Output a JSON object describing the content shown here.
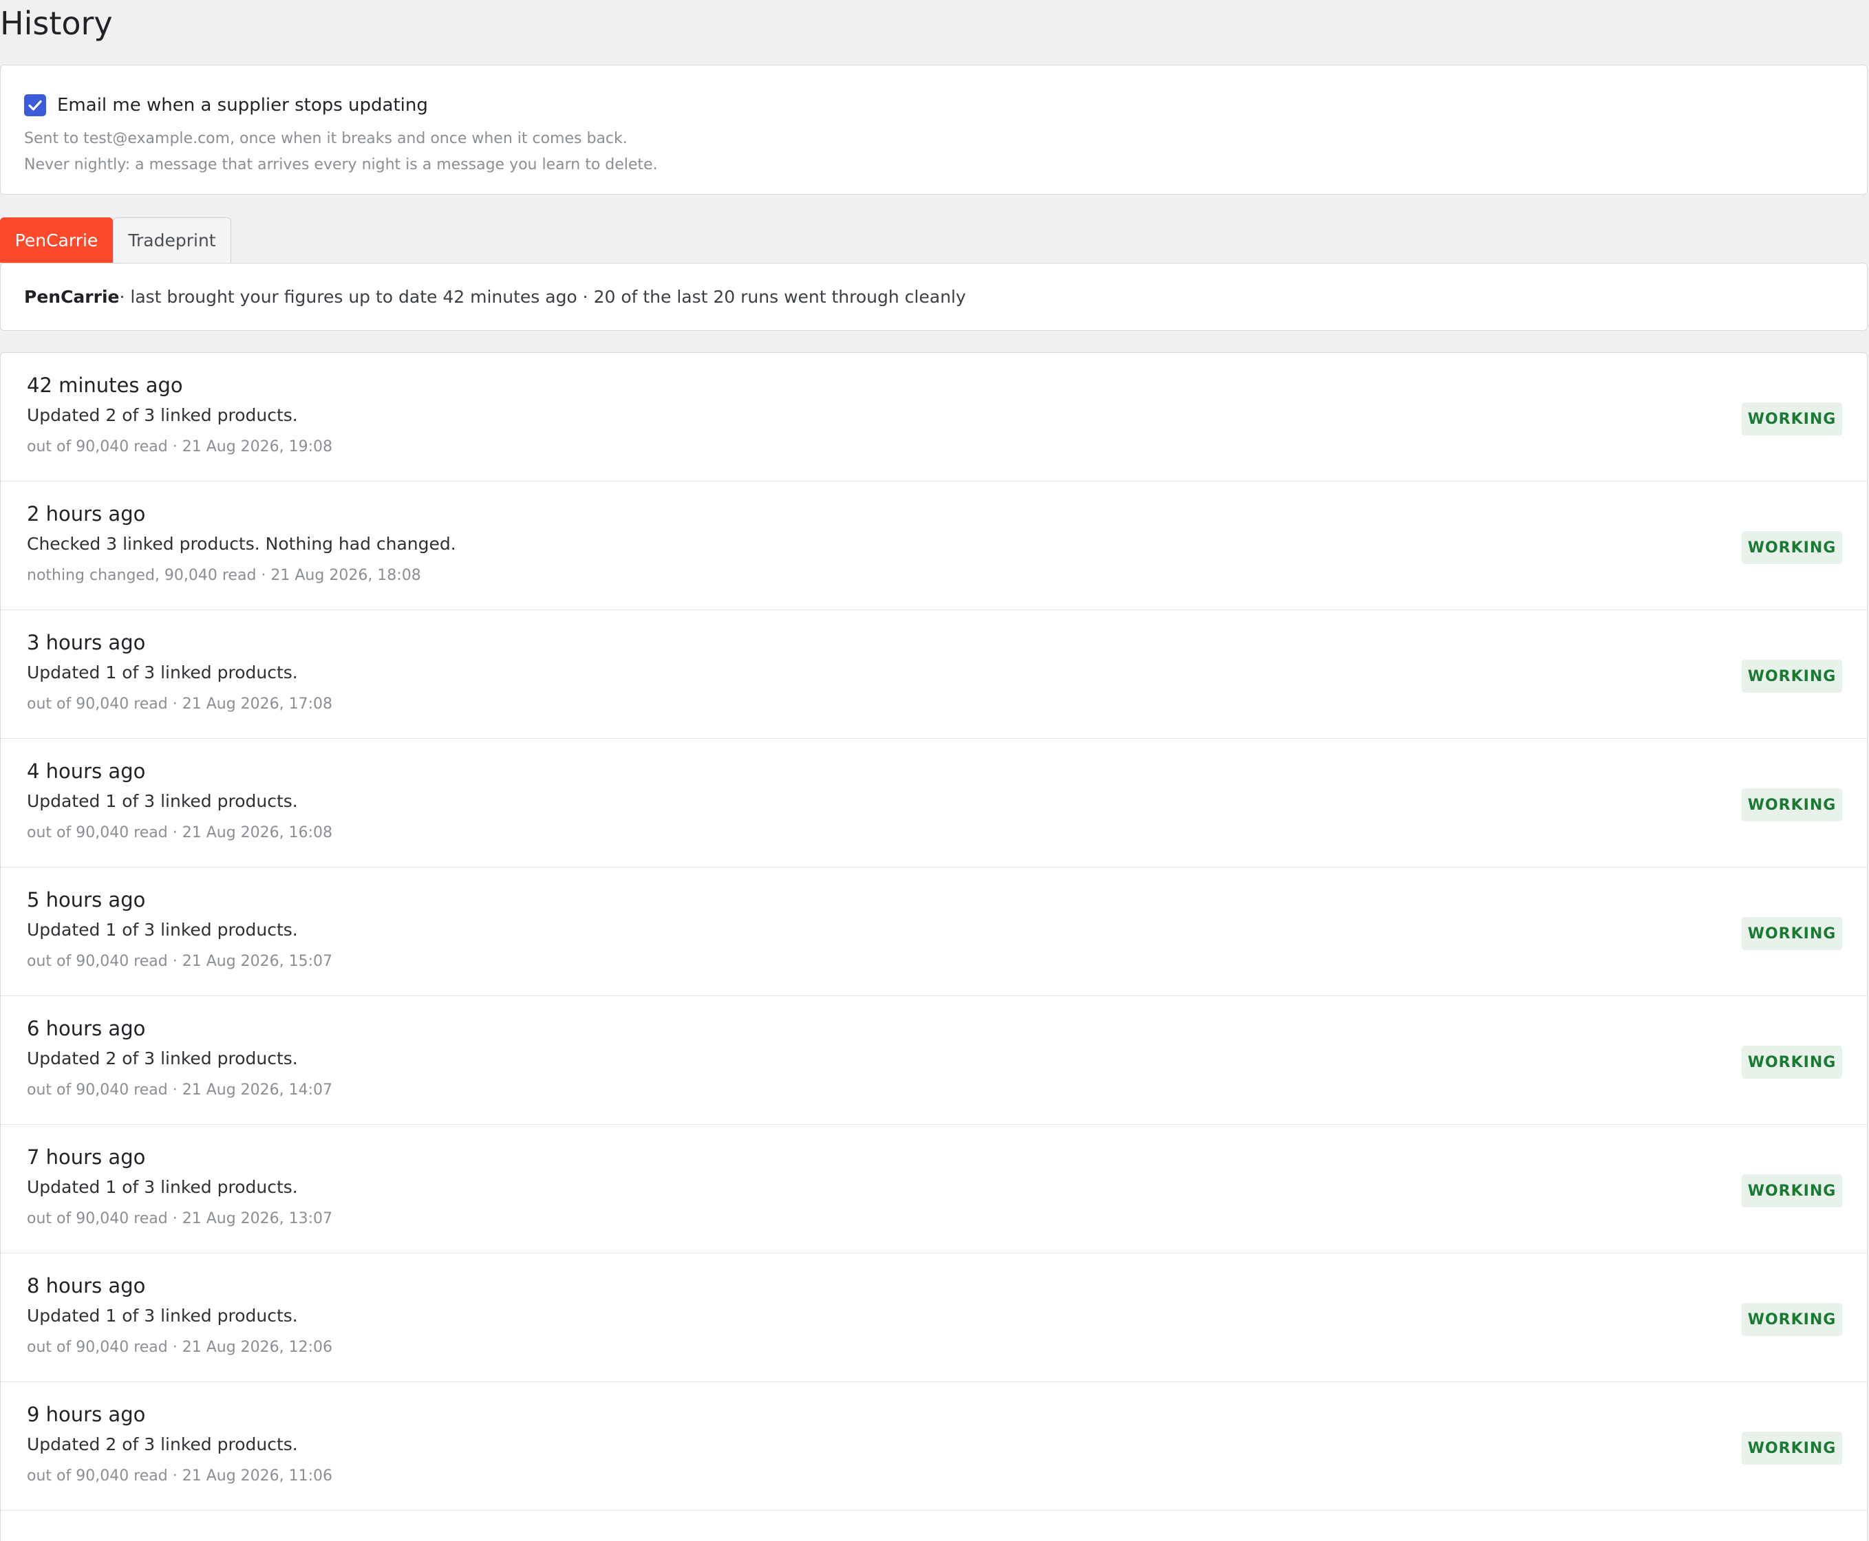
{
  "page": {
    "title": "History"
  },
  "notifications": {
    "checked": true,
    "label": "Email me when a supplier stops updating",
    "help": "Sent to test@example.com, once when it breaks and once when it comes back. Never nightly: a message that arrives every night is a message you learn to delete."
  },
  "tabs": [
    {
      "label": "PenCarrie",
      "active": true
    },
    {
      "label": "Tradeprint",
      "active": false
    }
  ],
  "summary": {
    "supplier": "PenCarrie",
    "text": " · last brought your figures up to date 42 minutes ago · 20 of the last 20 runs went through cleanly"
  },
  "colors": {
    "accent": "#fa4a2b",
    "checkbox": "#3b5bdb",
    "working_bg": "#e8f2ea",
    "working_text": "#1a7a33"
  },
  "runs": [
    {
      "when": "42 minutes ago",
      "summary": "Updated 2 of 3 linked products.",
      "detail": "out of 90,040 read · 21 Aug 2026, 19:08",
      "status": "WORKING"
    },
    {
      "when": "2 hours ago",
      "summary": "Checked 3 linked products. Nothing had changed.",
      "detail": "nothing changed, 90,040 read · 21 Aug 2026, 18:08",
      "status": "WORKING"
    },
    {
      "when": "3 hours ago",
      "summary": "Updated 1 of 3 linked products.",
      "detail": "out of 90,040 read · 21 Aug 2026, 17:08",
      "status": "WORKING"
    },
    {
      "when": "4 hours ago",
      "summary": "Updated 1 of 3 linked products.",
      "detail": "out of 90,040 read · 21 Aug 2026, 16:08",
      "status": "WORKING"
    },
    {
      "when": "5 hours ago",
      "summary": "Updated 1 of 3 linked products.",
      "detail": "out of 90,040 read · 21 Aug 2026, 15:07",
      "status": "WORKING"
    },
    {
      "when": "6 hours ago",
      "summary": "Updated 2 of 3 linked products.",
      "detail": "out of 90,040 read · 21 Aug 2026, 14:07",
      "status": "WORKING"
    },
    {
      "when": "7 hours ago",
      "summary": "Updated 1 of 3 linked products.",
      "detail": "out of 90,040 read · 21 Aug 2026, 13:07",
      "status": "WORKING"
    },
    {
      "when": "8 hours ago",
      "summary": "Updated 1 of 3 linked products.",
      "detail": "out of 90,040 read · 21 Aug 2026, 12:06",
      "status": "WORKING"
    },
    {
      "when": "9 hours ago",
      "summary": "Updated 2 of 3 linked products.",
      "detail": "out of 90,040 read · 21 Aug 2026, 11:06",
      "status": "WORKING"
    }
  ]
}
